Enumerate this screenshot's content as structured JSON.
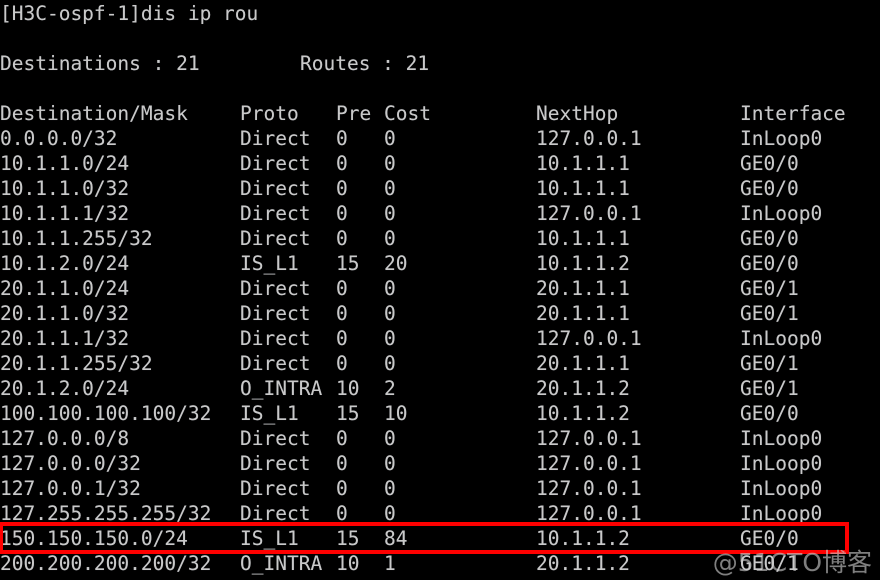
{
  "terminal": {
    "prompt_line": "[H3C-ospf-1]dis ip rou",
    "summary": {
      "destinations_label": "Destinations : 21",
      "routes_label": "Routes : 21"
    },
    "colors": {
      "background": "#000000",
      "text": "#c9c9c9",
      "highlight": "#ff0000",
      "watermark": "#cdcdcd"
    },
    "columns": {
      "destination": "Destination/Mask",
      "proto": "Proto",
      "pre": "Pre",
      "cost": "Cost",
      "nexthop": "NextHop",
      "interface": "Interface"
    },
    "rows": [
      {
        "destination": "0.0.0.0/32",
        "proto": "Direct",
        "pre": "0",
        "cost": "0",
        "nexthop": "127.0.0.1",
        "interface": "InLoop0"
      },
      {
        "destination": "10.1.1.0/24",
        "proto": "Direct",
        "pre": "0",
        "cost": "0",
        "nexthop": "10.1.1.1",
        "interface": "GE0/0"
      },
      {
        "destination": "10.1.1.0/32",
        "proto": "Direct",
        "pre": "0",
        "cost": "0",
        "nexthop": "10.1.1.1",
        "interface": "GE0/0"
      },
      {
        "destination": "10.1.1.1/32",
        "proto": "Direct",
        "pre": "0",
        "cost": "0",
        "nexthop": "127.0.0.1",
        "interface": "InLoop0"
      },
      {
        "destination": "10.1.1.255/32",
        "proto": "Direct",
        "pre": "0",
        "cost": "0",
        "nexthop": "10.1.1.1",
        "interface": "GE0/0"
      },
      {
        "destination": "10.1.2.0/24",
        "proto": "IS_L1",
        "pre": "15",
        "cost": "20",
        "nexthop": "10.1.1.2",
        "interface": "GE0/0"
      },
      {
        "destination": "20.1.1.0/24",
        "proto": "Direct",
        "pre": "0",
        "cost": "0",
        "nexthop": "20.1.1.1",
        "interface": "GE0/1"
      },
      {
        "destination": "20.1.1.0/32",
        "proto": "Direct",
        "pre": "0",
        "cost": "0",
        "nexthop": "20.1.1.1",
        "interface": "GE0/1"
      },
      {
        "destination": "20.1.1.1/32",
        "proto": "Direct",
        "pre": "0",
        "cost": "0",
        "nexthop": "127.0.0.1",
        "interface": "InLoop0"
      },
      {
        "destination": "20.1.1.255/32",
        "proto": "Direct",
        "pre": "0",
        "cost": "0",
        "nexthop": "20.1.1.1",
        "interface": "GE0/1"
      },
      {
        "destination": "20.1.2.0/24",
        "proto": "O_INTRA",
        "pre": "10",
        "cost": "2",
        "nexthop": "20.1.1.2",
        "interface": "GE0/1"
      },
      {
        "destination": "100.100.100.100/32",
        "proto": "IS_L1",
        "pre": "15",
        "cost": "10",
        "nexthop": "10.1.1.2",
        "interface": "GE0/0"
      },
      {
        "destination": "127.0.0.0/8",
        "proto": "Direct",
        "pre": "0",
        "cost": "0",
        "nexthop": "127.0.0.1",
        "interface": "InLoop0"
      },
      {
        "destination": "127.0.0.0/32",
        "proto": "Direct",
        "pre": "0",
        "cost": "0",
        "nexthop": "127.0.0.1",
        "interface": "InLoop0"
      },
      {
        "destination": "127.0.0.1/32",
        "proto": "Direct",
        "pre": "0",
        "cost": "0",
        "nexthop": "127.0.0.1",
        "interface": "InLoop0"
      },
      {
        "destination": "127.255.255.255/32",
        "proto": "Direct",
        "pre": "0",
        "cost": "0",
        "nexthop": "127.0.0.1",
        "interface": "InLoop0"
      },
      {
        "destination": "150.150.150.0/24",
        "proto": "IS_L1",
        "pre": "15",
        "cost": "84",
        "nexthop": "10.1.1.2",
        "interface": "GE0/0"
      },
      {
        "destination": "200.200.200.200/32",
        "proto": "O_INTRA",
        "pre": "10",
        "cost": "1",
        "nexthop": "20.1.1.2",
        "interface": "GE0/1"
      }
    ],
    "highlighted_row_index": 16,
    "watermark": "@51CTO博客"
  }
}
